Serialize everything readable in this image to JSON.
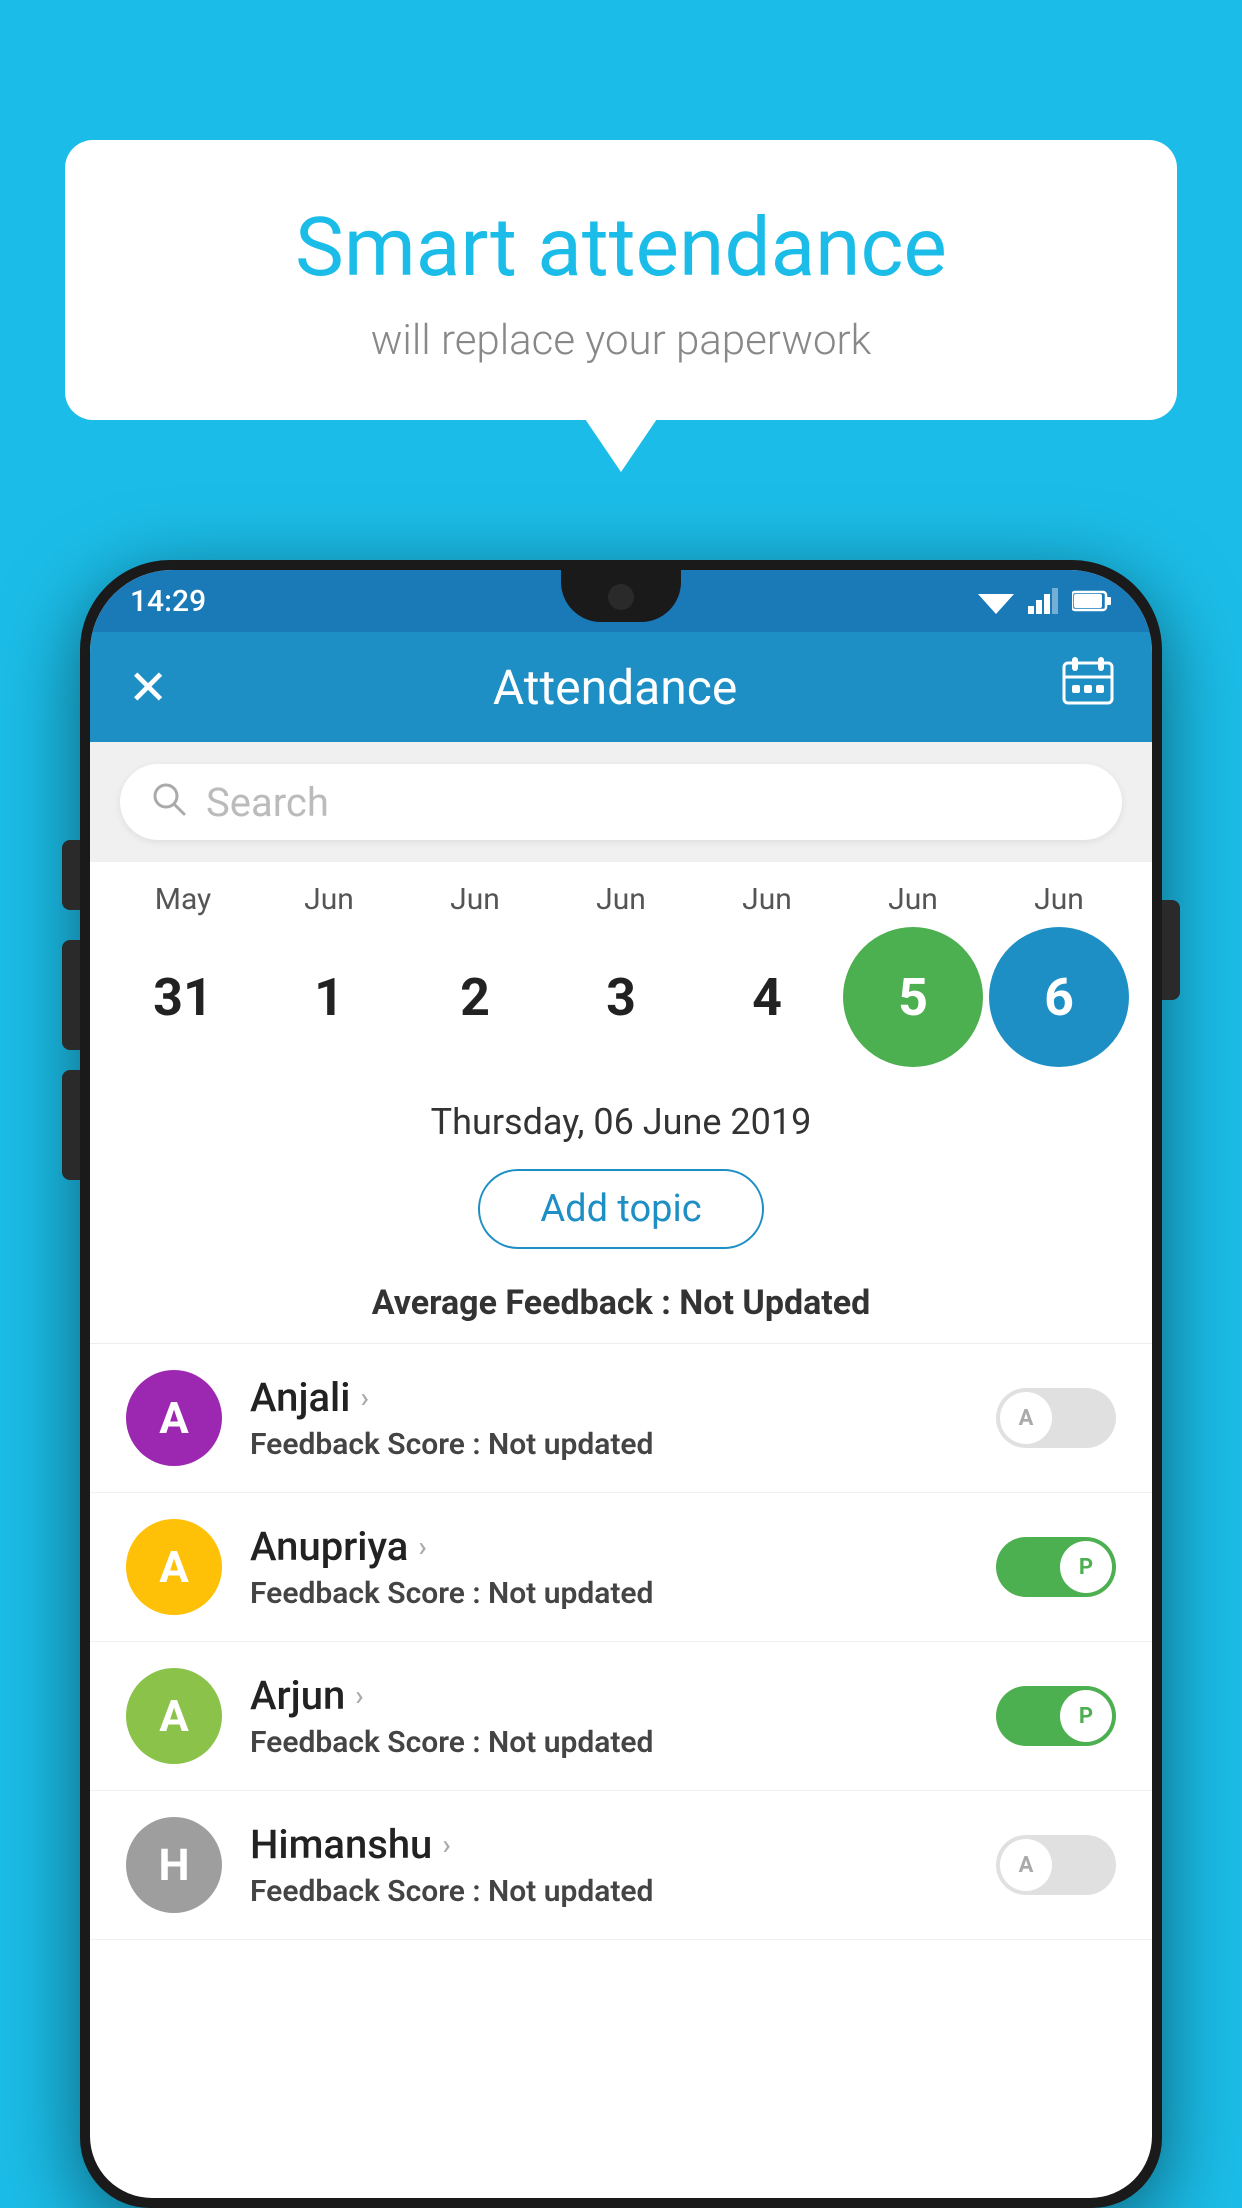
{
  "background_color": "#1BBDE8",
  "speech_bubble": {
    "title": "Smart attendance",
    "subtitle": "will replace your paperwork"
  },
  "phone": {
    "status_bar": {
      "time": "14:29"
    },
    "app_bar": {
      "title": "Attendance",
      "close_label": "✕",
      "calendar_label": "📅"
    },
    "search": {
      "placeholder": "Search"
    },
    "calendar": {
      "months": [
        "May",
        "Jun",
        "Jun",
        "Jun",
        "Jun",
        "Jun",
        "Jun"
      ],
      "dates": [
        "31",
        "1",
        "2",
        "3",
        "4",
        "5",
        "6"
      ],
      "selected_green_index": 5,
      "selected_blue_index": 6
    },
    "selected_date": "Thursday, 06 June 2019",
    "add_topic_label": "Add topic",
    "avg_feedback_label": "Average Feedback : ",
    "avg_feedback_value": "Not Updated",
    "students": [
      {
        "name": "Anjali",
        "avatar_letter": "A",
        "avatar_color": "#9C27B0",
        "feedback_label": "Feedback Score : ",
        "feedback_value": "Not updated",
        "attendance": "absent",
        "toggle_letter": "A"
      },
      {
        "name": "Anupriya",
        "avatar_letter": "A",
        "avatar_color": "#FFC107",
        "feedback_label": "Feedback Score : ",
        "feedback_value": "Not updated",
        "attendance": "present",
        "toggle_letter": "P"
      },
      {
        "name": "Arjun",
        "avatar_letter": "A",
        "avatar_color": "#8BC34A",
        "feedback_label": "Feedback Score : ",
        "feedback_value": "Not updated",
        "attendance": "present",
        "toggle_letter": "P"
      },
      {
        "name": "Himanshu",
        "avatar_letter": "H",
        "avatar_color": "#9E9E9E",
        "feedback_label": "Feedback Score : ",
        "feedback_value": "Not updated",
        "attendance": "absent",
        "toggle_letter": "A"
      }
    ]
  }
}
